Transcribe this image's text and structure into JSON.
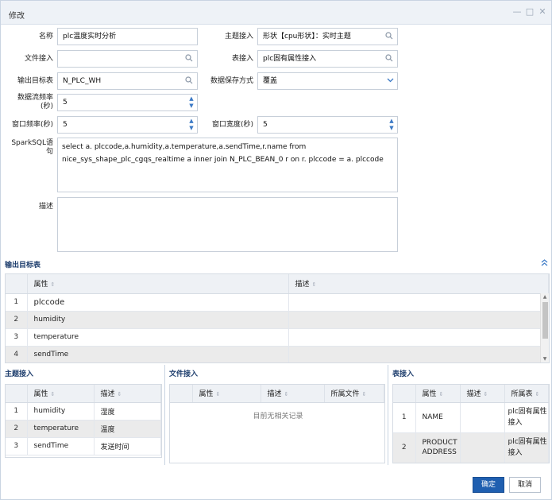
{
  "dialog": {
    "title": "修改",
    "minimize": "—",
    "maximize": "□",
    "close": "✕"
  },
  "form": {
    "name_label": "名称",
    "name_value": "plc温度实时分析",
    "topic_label": "主题接入",
    "topic_value": "形状【cpu形状】：实时主题",
    "file_label": "文件接入",
    "file_value": "",
    "table_label": "表接入",
    "table_value": "plc固有属性接入",
    "output_label": "输出目标表",
    "output_value": "N_PLC_WH",
    "save_mode_label": "数据保存方式",
    "save_mode_value": "覆盖",
    "stream_freq_label": "数据流频率(秒)",
    "stream_freq_value": "5",
    "window_freq_label": "窗口频率(秒)",
    "window_freq_value": "5",
    "window_width_label": "窗口宽度(秒)",
    "window_width_value": "5",
    "sql_label": "SparkSQL语句",
    "sql_value": "select a. plccode,a.humidity,a.temperature,a.sendTime,r.name from nice_sys_shape_plc_cgqs_realtime a inner join N_PLC_BEAN_0 r on r. plccode = a. plccode",
    "desc_label": "描述",
    "desc_value": ""
  },
  "output_table": {
    "section_title": "输出目标表",
    "headers": [
      "属性",
      "描述"
    ],
    "rows": [
      {
        "num": "1",
        "attr": "plccode",
        "desc": ""
      },
      {
        "num": "2",
        "attr": "humidity",
        "desc": ""
      },
      {
        "num": "3",
        "attr": "temperature",
        "desc": ""
      },
      {
        "num": "4",
        "attr": "sendTime",
        "desc": ""
      }
    ]
  },
  "topic_panel": {
    "section_title": "主题接入",
    "headers": [
      "属性",
      "描述"
    ],
    "rows": [
      {
        "num": "1",
        "attr": "humidity",
        "desc": "湿度"
      },
      {
        "num": "2",
        "attr": "temperature",
        "desc": "温度"
      },
      {
        "num": "3",
        "attr": "sendTime",
        "desc": "发送时间"
      }
    ]
  },
  "file_panel": {
    "section_title": "文件接入",
    "headers": [
      "属性",
      "描述",
      "所属文件"
    ],
    "empty_text": "目前无相关记录"
  },
  "table_panel": {
    "section_title": "表接入",
    "headers": [
      "属性",
      "描述",
      "所属表"
    ],
    "rows": [
      {
        "num": "1",
        "attr": "NAME",
        "desc": "",
        "owner": "plc固有属性接入"
      },
      {
        "num": "2",
        "attr": "PRODUCTADDRESS",
        "desc": "",
        "owner": "plc固有属性接入"
      }
    ]
  },
  "footer": {
    "ok_label": "确定",
    "cancel_label": "取消"
  },
  "colors": {
    "primary": "#1f5fb0",
    "header_bg": "#eef2f7",
    "section_title": "#1f3f6e"
  }
}
